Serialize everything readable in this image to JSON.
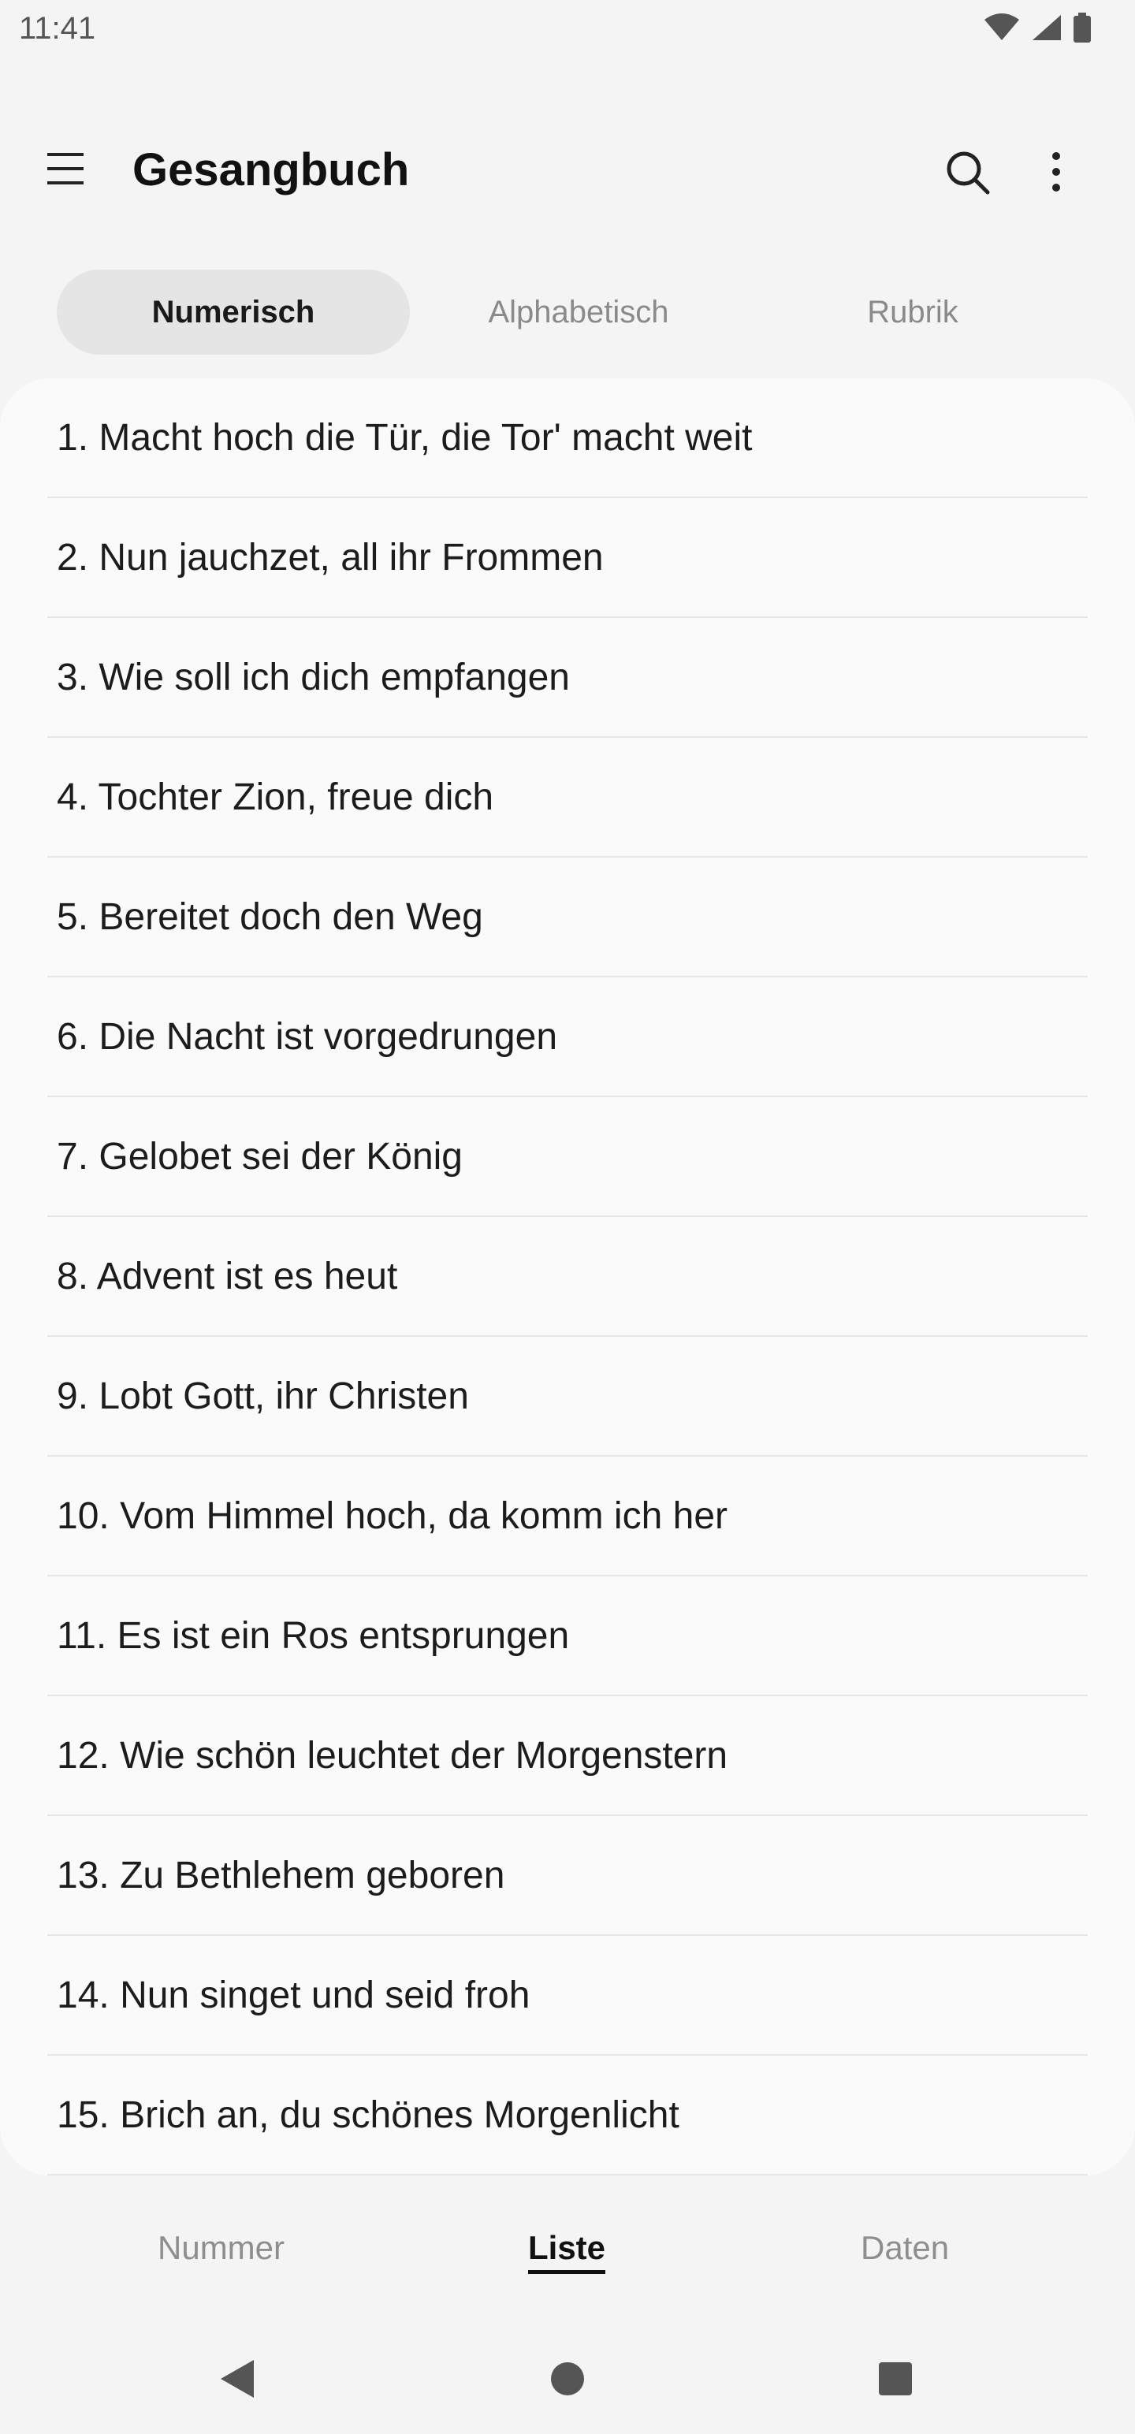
{
  "status_bar": {
    "time": "11:41"
  },
  "app_bar": {
    "title": "Gesangbuch"
  },
  "tabs": [
    {
      "label": "Numerisch",
      "active": true
    },
    {
      "label": "Alphabetisch",
      "active": false
    },
    {
      "label": "Rubrik",
      "active": false
    }
  ],
  "songs": [
    "1. Macht hoch die Tür, die Tor' macht weit",
    "2. Nun jauchzet, all ihr Frommen",
    "3. Wie soll ich dich empfangen",
    "4. Tochter Zion, freue dich",
    "5. Bereitet doch den Weg",
    "6. Die Nacht ist vorgedrungen",
    "7. Gelobet sei der König",
    "8. Advent ist es heut",
    "9. Lobt Gott, ihr Christen",
    "10. Vom Himmel hoch, da komm ich her",
    "11. Es ist ein Ros entsprungen",
    "12. Wie schön leuchtet der Morgenstern",
    "13. Zu Bethlehem geboren",
    "14. Nun singet und seid froh",
    "15. Brich an, du schönes Morgenlicht"
  ],
  "bottom_nav": [
    {
      "label": "Nummer",
      "active": false
    },
    {
      "label": "Liste",
      "active": true
    },
    {
      "label": "Daten",
      "active": false
    }
  ]
}
